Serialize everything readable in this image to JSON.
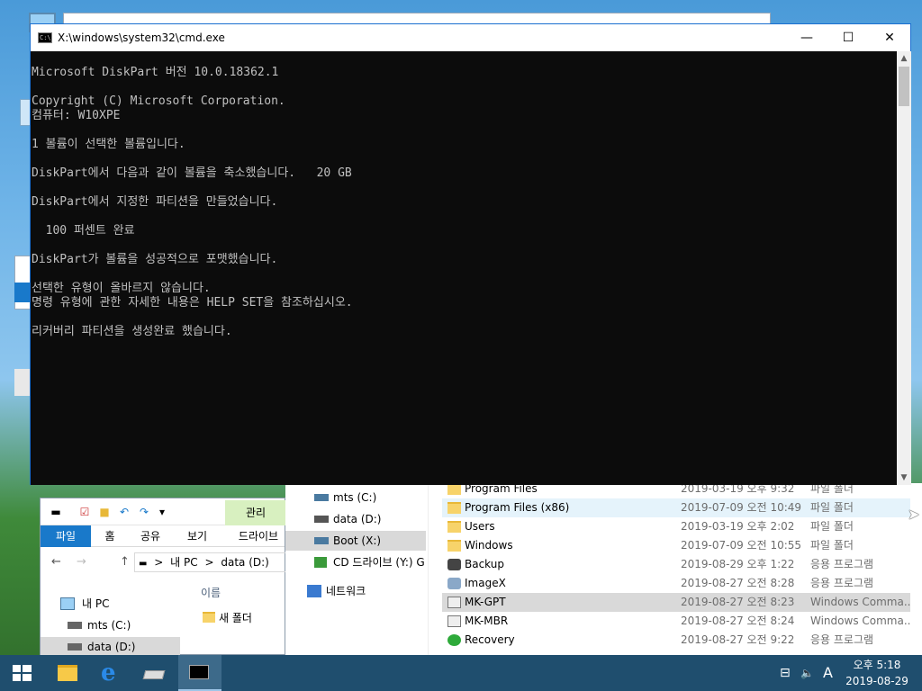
{
  "cmd": {
    "title": "X:\\windows\\system32\\cmd.exe",
    "icon": "console-icon",
    "icon_text": "C:\\",
    "minimize_glyph": "—",
    "maximize_glyph": "☐",
    "close_glyph": "✕",
    "lines": [
      "Microsoft DiskPart 버전 10.0.18362.1",
      "Copyright (C) Microsoft Corporation.",
      "컴퓨터: W10XPE",
      "1 볼륨이 선택한 볼륨입니다.",
      "DiskPart에서 다음과 같이 볼륨을 축소했습니다.   20 GB",
      "DiskPart에서 지정한 파티션을 만들었습니다.",
      "  100 퍼센트 완료",
      "DiskPart가 볼륨을 성공적으로 포맷했습니다.",
      "선택한 유형이 올바르지 않습니다.",
      "명령 유형에 관한 자세한 내용은 HELP SET을 참조하십시오.",
      "리커버리 파티션을 생성완료 했습니다."
    ],
    "scroll_up": "▲",
    "scroll_down": "▼"
  },
  "explorer_left": {
    "manage_tab": "관리",
    "tabs": [
      "파일",
      "홈",
      "공유",
      "보기",
      "드라이브"
    ],
    "address": {
      "back": "←",
      "forward": "→",
      "up": "↑",
      "path": [
        "내 PC",
        "data (D:)"
      ],
      "separator": ">"
    },
    "tree": [
      {
        "label": "내 PC"
      },
      {
        "label": "mts (C:)"
      },
      {
        "label": "data (D:)"
      }
    ],
    "column_name": "이름",
    "items": [
      "새 폴더"
    ]
  },
  "explorer_mid_nav": {
    "items": [
      {
        "label": "mts (C:)"
      },
      {
        "label": "data (D:)"
      },
      {
        "label": "Boot (X:)"
      },
      {
        "label": "CD 드라이브 (Y:) G"
      }
    ],
    "network": "네트워크"
  },
  "file_list": {
    "rows": [
      {
        "name": "Program Files",
        "date": "2019-03-19 오후 9:32",
        "type": "파일 폴더",
        "icon": "folder-icon"
      },
      {
        "name": "Program Files (x86)",
        "date": "2019-07-09 오전 10:49",
        "type": "파일 폴더",
        "icon": "folder-icon"
      },
      {
        "name": "Users",
        "date": "2019-03-19 오후 2:02",
        "type": "파일 폴더",
        "icon": "folder-icon"
      },
      {
        "name": "Windows",
        "date": "2019-07-09 오전 10:55",
        "type": "파일 폴더",
        "icon": "folder-icon"
      },
      {
        "name": "Backup",
        "date": "2019-08-29 오후 1:22",
        "type": "응용 프로그램",
        "icon": "backup-app-icon"
      },
      {
        "name": "ImageX",
        "date": "2019-08-27 오전 8:28",
        "type": "응용 프로그램",
        "icon": "imagex-app-icon"
      },
      {
        "name": "MK-GPT",
        "date": "2019-08-27 오전 8:23",
        "type": "Windows Comma...",
        "icon": "script-icon"
      },
      {
        "name": "MK-MBR",
        "date": "2019-08-27 오전 8:24",
        "type": "Windows Comma...",
        "icon": "script-icon"
      },
      {
        "name": "Recovery",
        "date": "2019-08-27 오전 9:22",
        "type": "응용 프로그램",
        "icon": "recovery-app-icon"
      }
    ]
  },
  "taskbar": {
    "clock_time": "오후 5:18",
    "clock_date": "2019-08-29",
    "ime": "A",
    "network_glyph": "⊟",
    "volume_glyph": "🔈"
  },
  "colors": {
    "console_bg": "#0c0c0c",
    "console_fg": "#c0c0c0",
    "taskbar": "#1f4e6e",
    "ribbon_file_tab": "#1979ca"
  }
}
